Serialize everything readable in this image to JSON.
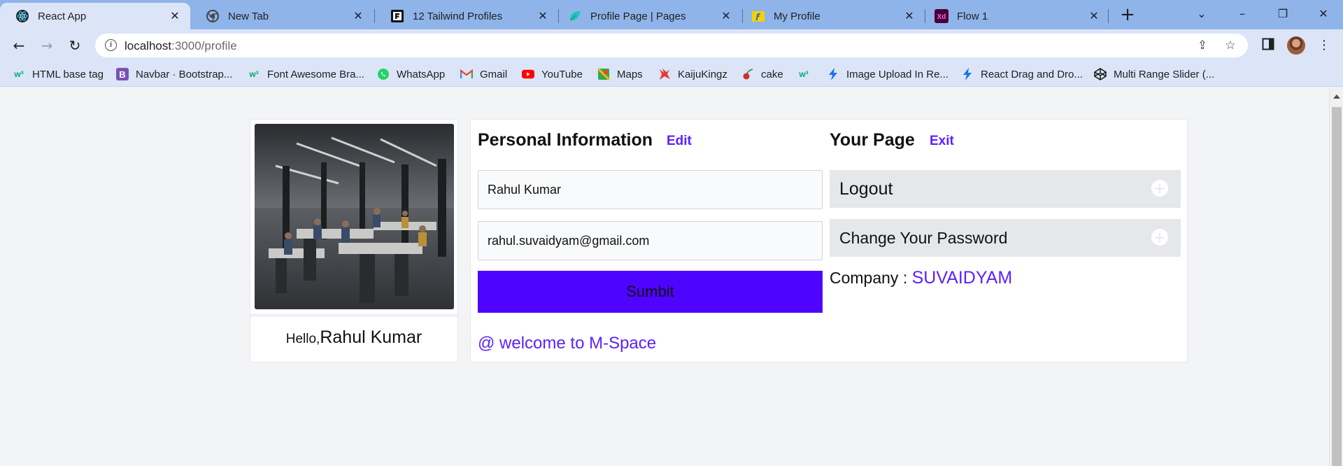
{
  "browser": {
    "tabs": [
      {
        "title": "React App",
        "icon": "react-icon",
        "active": true
      },
      {
        "title": "New Tab",
        "icon": "chrome-icon"
      },
      {
        "title": "12 Tailwind Profiles",
        "icon": "flowbite-f-icon"
      },
      {
        "title": "Profile Page | Pages",
        "icon": "leaf-icon"
      },
      {
        "title": "My Profile",
        "icon": "flipkart-icon"
      },
      {
        "title": "Flow 1",
        "icon": "adobe-xd-icon"
      }
    ],
    "url_host": "localhost",
    "url_rest": ":3000/profile",
    "bookmarks": [
      {
        "label": "HTML base tag",
        "icon": "w3schools-icon",
        "color": "#04aa6d"
      },
      {
        "label": "Navbar · Bootstrap...",
        "icon": "bootstrap-icon",
        "color": "#7952b3"
      },
      {
        "label": "Font Awesome Bra...",
        "icon": "w3schools-icon",
        "color": "#04aa6d"
      },
      {
        "label": "WhatsApp",
        "icon": "whatsapp-icon",
        "color": "#25d366"
      },
      {
        "label": "Gmail",
        "icon": "gmail-icon",
        "color": "#ea4335"
      },
      {
        "label": "YouTube",
        "icon": "youtube-icon",
        "color": "#ff0000"
      },
      {
        "label": "Maps",
        "icon": "maps-icon",
        "color": "#34a853"
      },
      {
        "label": "KaijuKingz",
        "icon": "kaijukingz-icon",
        "color": "#e53935"
      },
      {
        "label": "cake",
        "icon": "cherry-icon",
        "color": "#d32f2f"
      },
      {
        "label": "",
        "icon": "w3schools-icon",
        "color": "#04aa6d"
      },
      {
        "label": "Image Upload In Re...",
        "icon": "bolt-icon",
        "color": "#1a73e8"
      },
      {
        "label": "React Drag and Dro...",
        "icon": "bolt-icon",
        "color": "#1a73e8"
      },
      {
        "label": "Multi Range Slider (...",
        "icon": "codepen-icon",
        "color": "#111111"
      }
    ]
  },
  "profile": {
    "hello_prefix": "Hello,",
    "name": "Rahul Kumar"
  },
  "personal_info": {
    "title": "Personal Information",
    "edit_label": "Edit",
    "name_value": "Rahul Kumar",
    "email_value": "rahul.suvaidyam@gmail.com",
    "submit_label": "Sumbit",
    "welcome_text": "@ welcome to M-Space"
  },
  "your_page": {
    "title": "Your Page",
    "exit_label": "Exit",
    "logout_label": "Logout",
    "change_password_label": "Change Your Password",
    "company_label": "Company :",
    "company_value": "SUVAIDYAM"
  },
  "colors": {
    "accent": "#5b21ff",
    "submit_bg": "#4f04ff",
    "tab_strip": "#8fb4ea",
    "toolbar": "#dbe5f7"
  }
}
